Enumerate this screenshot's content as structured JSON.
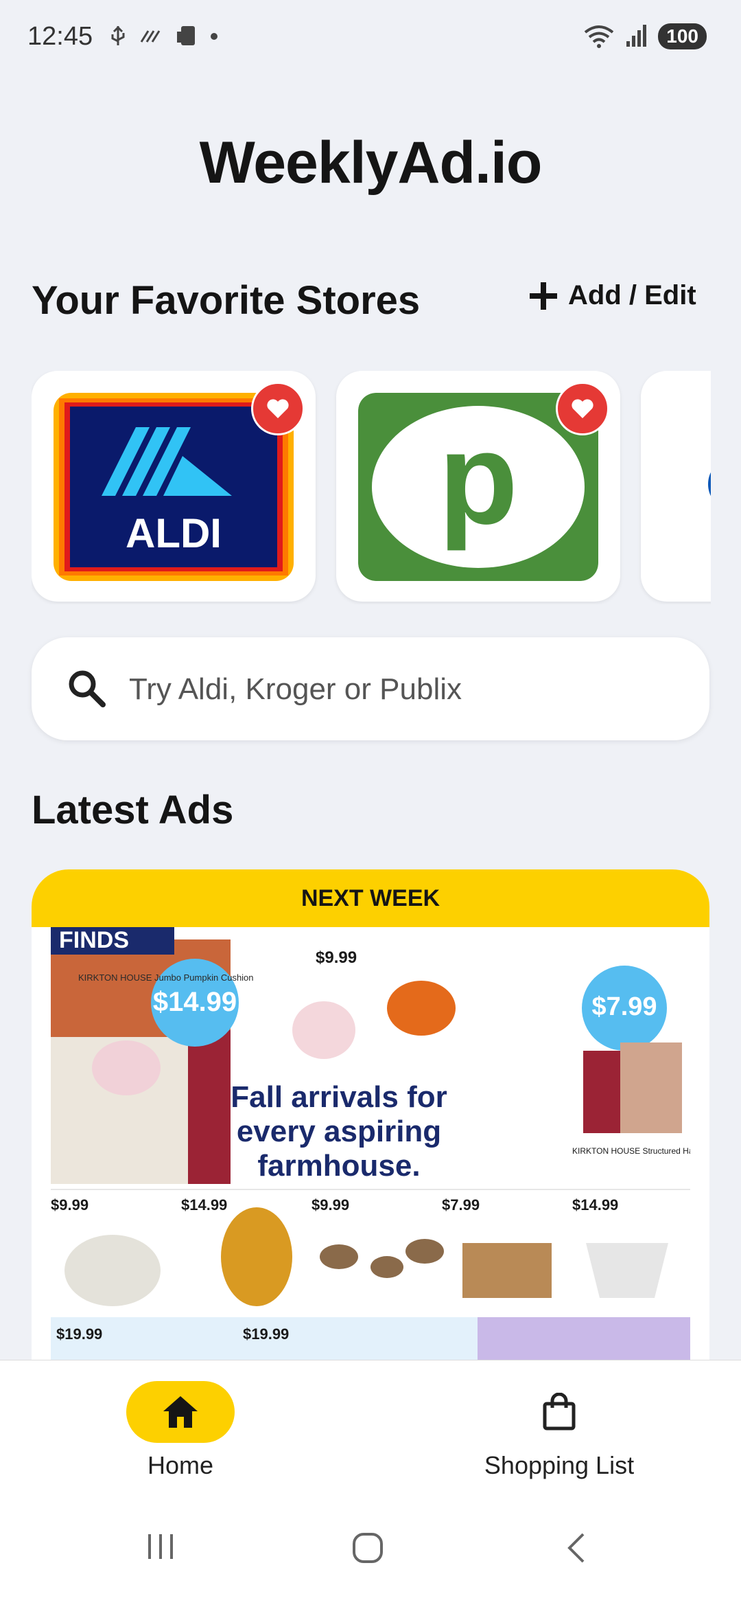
{
  "status_bar": {
    "time": "12:45",
    "battery": "100"
  },
  "app": {
    "title": "WeeklyAd.io"
  },
  "favorites": {
    "heading": "Your Favorite Stores",
    "add_edit_label": "Add / Edit",
    "stores": [
      {
        "name": "ALDI",
        "logo_text": "ALDI"
      },
      {
        "name": "Publix",
        "logo_text": "p"
      }
    ]
  },
  "search": {
    "placeholder": "Try Aldi, Kroger or Publix",
    "value": ""
  },
  "latest_ads": {
    "heading": "Latest Ads",
    "ad": {
      "banner": "NEXT WEEK",
      "corner_label": "FINDS",
      "headline_line1": "Fall arrivals for",
      "headline_line2": "every aspiring",
      "headline_line3": "farmhouse.",
      "hero_product": "KIRKTON HOUSE Jumbo Pumpkin Cushion",
      "hero_price": "$14.99",
      "second_price": "$9.99",
      "third_price": "$7.99",
      "third_product": "KIRKTON HOUSE Structured Harvest Throw",
      "row_prices": [
        "$9.99",
        "$14.99",
        "$9.99",
        "$7.99",
        "$14.99"
      ],
      "bottom_prices": [
        "$19.99",
        "$19.99"
      ]
    }
  },
  "bottom_nav": {
    "items": [
      {
        "label": "Home",
        "icon": "home-icon",
        "active": true
      },
      {
        "label": "Shopping List",
        "icon": "shopping-bag-icon",
        "active": false
      }
    ]
  },
  "colors": {
    "accent": "#fdd000",
    "favorite": "#e53935",
    "publix_green": "#4a8f3b",
    "aldi_navy": "#0a1a6b"
  }
}
